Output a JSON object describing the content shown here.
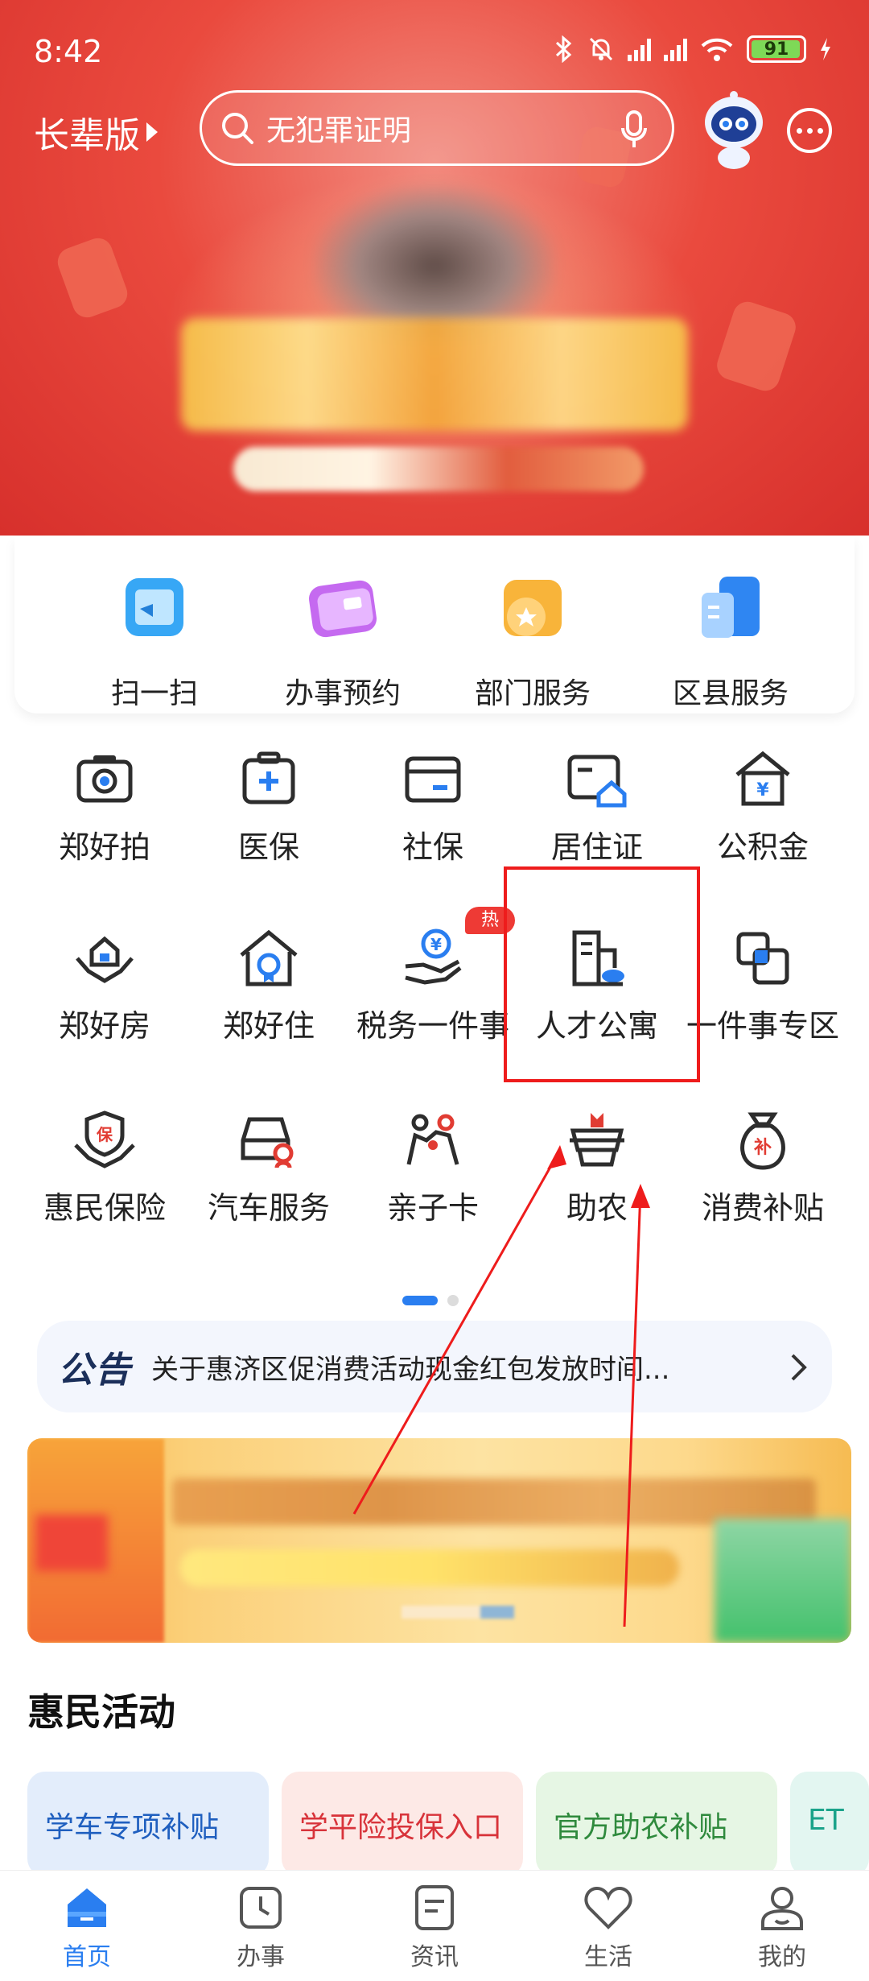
{
  "status_bar": {
    "time": "8:42",
    "battery": "91"
  },
  "header": {
    "elder_mode": "长辈版",
    "search_placeholder": "无犯罪证明"
  },
  "quick_services": [
    {
      "label": "扫一扫",
      "icon": "scan-icon"
    },
    {
      "label": "办事预约",
      "icon": "appointment-icon"
    },
    {
      "label": "部门服务",
      "icon": "department-icon"
    },
    {
      "label": "区县服务",
      "icon": "district-icon"
    }
  ],
  "services": [
    {
      "label": "郑好拍",
      "icon": "camera-icon"
    },
    {
      "label": "医保",
      "icon": "medical-insurance-icon"
    },
    {
      "label": "社保",
      "icon": "social-security-card-icon"
    },
    {
      "label": "居住证",
      "icon": "residence-permit-icon"
    },
    {
      "label": "公积金",
      "icon": "housing-fund-icon"
    },
    {
      "label": "郑好房",
      "icon": "house-hands-icon"
    },
    {
      "label": "郑好住",
      "icon": "home-badge-icon"
    },
    {
      "label": "税务一件事",
      "icon": "tax-hand-icon"
    },
    {
      "label": "人才公寓",
      "icon": "talent-apartment-icon"
    },
    {
      "label": "一件事专区",
      "icon": "overlap-squares-icon"
    },
    {
      "label": "惠民保险",
      "icon": "insurance-shield-icon"
    },
    {
      "label": "汽车服务",
      "icon": "car-icon"
    },
    {
      "label": "亲子卡",
      "icon": "family-icon"
    },
    {
      "label": "助农",
      "icon": "farm-basket-icon"
    },
    {
      "label": "消费补贴",
      "icon": "subsidy-bag-icon"
    }
  ],
  "hot_badge": "热",
  "notice": {
    "tag": "公告",
    "text": "关于惠济区促消费活动现金红包发放时间..."
  },
  "section": {
    "title": "惠民活动"
  },
  "activities": [
    {
      "title": "学车专项补贴",
      "color": "#1f5fbf",
      "bg": "#e3edfb"
    },
    {
      "title": "学平险投保入口",
      "color": "#d8333a",
      "bg": "#fde9e6"
    },
    {
      "title": "官方助农补贴",
      "color": "#2f8a3d",
      "bg": "#e6f6e4"
    },
    {
      "title": "ET",
      "color": "#1aa38a",
      "bg": "#e3f6f1"
    }
  ],
  "bottom_nav": [
    {
      "label": "首页",
      "icon": "home-icon",
      "active": true
    },
    {
      "label": "办事",
      "icon": "clock-icon",
      "active": false
    },
    {
      "label": "资讯",
      "icon": "news-icon",
      "active": false
    },
    {
      "label": "生活",
      "icon": "heart-icon",
      "active": false
    },
    {
      "label": "我的",
      "icon": "profile-icon",
      "active": false
    }
  ],
  "colors": {
    "accent": "#2a7ef0",
    "banner_red": "#e8433a",
    "highlight": "#ee1c1c"
  }
}
